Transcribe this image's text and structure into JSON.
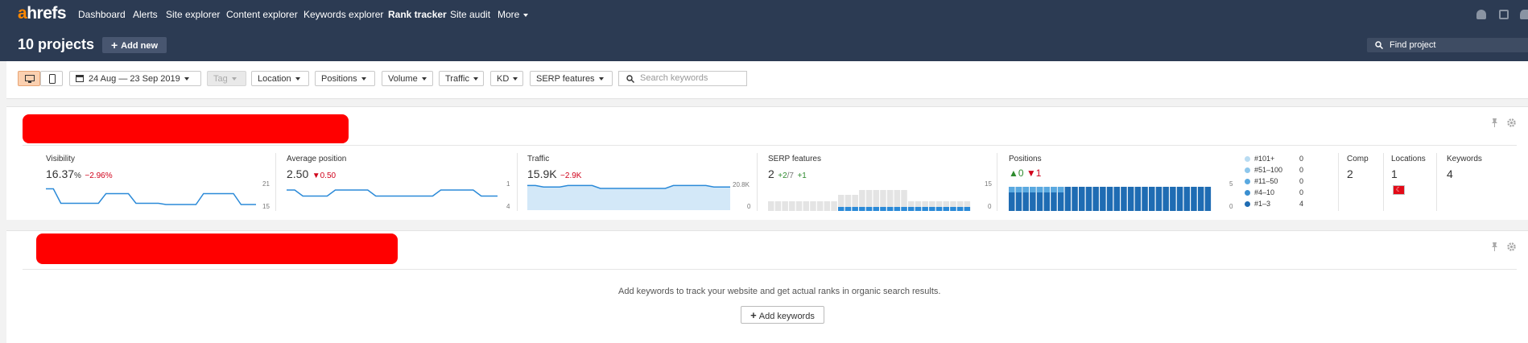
{
  "header": {
    "logo_a": "a",
    "logo_rest": "hrefs",
    "nav": [
      "Dashboard",
      "Alerts",
      "Site explorer",
      "Content explorer",
      "Keywords explorer",
      "Rank tracker",
      "Site audit",
      "More"
    ],
    "title": "10 projects",
    "add_new": "Add new",
    "find_placeholder": "Find project"
  },
  "filters": {
    "date_range": "24 Aug — 23 Sep 2019",
    "tag": "Tag",
    "location": "Location",
    "positions": "Positions",
    "volume": "Volume",
    "traffic": "Traffic",
    "kd": "KD",
    "serp_features": "SERP features",
    "search_placeholder": "Search keywords"
  },
  "project1": {
    "visibility": {
      "label": "Visibility",
      "value": "16.37",
      "unit": "%",
      "change": "−2.96%",
      "axis_top": "21",
      "axis_bottom": "15"
    },
    "avg_position": {
      "label": "Average position",
      "value": "2.50",
      "change": "▼0.50",
      "axis_top": "1",
      "axis_bottom": "4"
    },
    "traffic": {
      "label": "Traffic",
      "value": "15.9K",
      "change": "−2.9K",
      "axis_top": "20.8K",
      "axis_bottom": "0"
    },
    "serp": {
      "label": "SERP features",
      "value": "2",
      "d1": "+2",
      "d2": "/7",
      "d3": "+1",
      "axis_top": "15",
      "axis_bottom": "0"
    },
    "positions": {
      "label": "Positions",
      "up": "▲0",
      "down": "▼1",
      "axis_top": "5",
      "axis_bottom": "0"
    },
    "legend": [
      {
        "name": "#101+",
        "count": "0",
        "color": "#b9dcf2"
      },
      {
        "name": "#51–100",
        "count": "0",
        "color": "#8ec7ec"
      },
      {
        "name": "#11–50",
        "count": "0",
        "color": "#5aa9e0"
      },
      {
        "name": "#4–10",
        "count": "0",
        "color": "#3a8fd0"
      },
      {
        "name": "#1–3",
        "count": "4",
        "color": "#1f6cb3"
      }
    ],
    "comp": {
      "label": "Comp",
      "value": "2"
    },
    "locations": {
      "label": "Locations",
      "value": "1",
      "flag": "☾"
    },
    "keywords": {
      "label": "Keywords",
      "value": "4"
    }
  },
  "project2": {
    "empty_message": "Add keywords to track your website and get actual ranks in organic search results.",
    "add_keywords": "Add keywords"
  },
  "colors": {
    "header_bg": "#2c3b53",
    "accent": "#ff8800",
    "chart_line": "#2b8ad8",
    "chart_fill": "#d3e8f8",
    "negative": "#d0021b",
    "positive": "#2e8b2e"
  }
}
